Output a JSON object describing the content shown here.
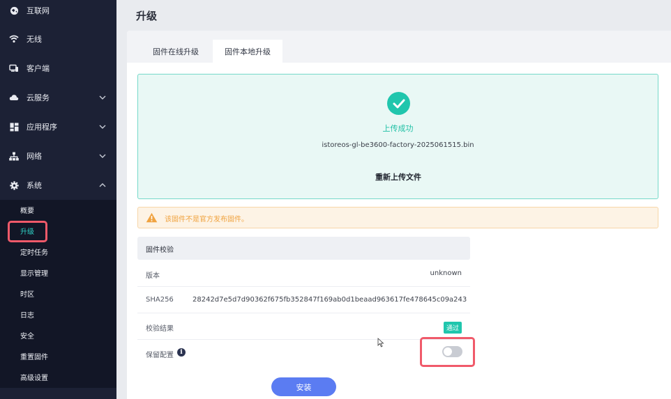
{
  "sidebar": {
    "items": [
      {
        "label": "互联网",
        "icon": "globe-icon",
        "expandable": false
      },
      {
        "label": "无线",
        "icon": "wifi-icon",
        "expandable": false
      },
      {
        "label": "客户端",
        "icon": "devices-icon",
        "expandable": false
      },
      {
        "label": "云服务",
        "icon": "cloud-icon",
        "expandable": true
      },
      {
        "label": "应用程序",
        "icon": "apps-icon",
        "expandable": true
      },
      {
        "label": "网络",
        "icon": "network-icon",
        "expandable": true
      },
      {
        "label": "系统",
        "icon": "gear-icon",
        "expandable": true,
        "expanded": true
      }
    ],
    "system_subitems": [
      {
        "label": "概要"
      },
      {
        "label": "升级",
        "active": true
      },
      {
        "label": "定时任务"
      },
      {
        "label": "显示管理"
      },
      {
        "label": "时区"
      },
      {
        "label": "日志"
      },
      {
        "label": "安全"
      },
      {
        "label": "重置固件"
      },
      {
        "label": "高级设置"
      }
    ]
  },
  "page": {
    "title": "升级"
  },
  "tabs": [
    {
      "label": "固件在线升级",
      "active": false
    },
    {
      "label": "固件本地升级",
      "active": true
    }
  ],
  "upload": {
    "status": "上传成功",
    "filename": "istoreos-gl-be3600-factory-2025061515.bin",
    "reupload_label": "重新上传文件"
  },
  "warning": {
    "text": "该固件不是官方发布固件。"
  },
  "verify": {
    "title": "固件校验",
    "version_label": "版本",
    "version_value": "unknown",
    "sha_label": "SHA256",
    "sha_value": "28242d7e5d7d90362f675fb352847f169ab0d1beaad963617fe478645c09a243",
    "result_label": "校验结果",
    "result_value": "通过",
    "keep_config_label": "保留配置",
    "keep_config_on": false
  },
  "install_label": "安装",
  "colors": {
    "sidebar_bg": "#1c2135",
    "accent_teal": "#20c6ad",
    "primary_blue": "#5b7cf2",
    "highlight_red": "#f05a6a",
    "warning_orange": "#f0a340"
  }
}
